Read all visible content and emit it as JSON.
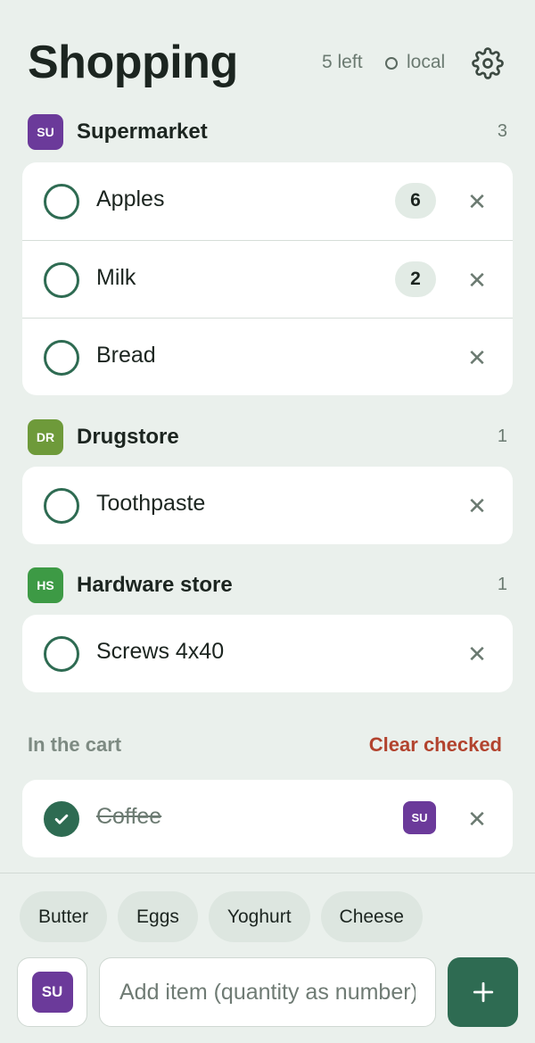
{
  "header": {
    "title": "Shopping",
    "left_count": "5 left",
    "sync_status": "local",
    "settings_icon": "gear-icon"
  },
  "groups": [
    {
      "badge": "SU",
      "badge_color": "#6b3a9a",
      "name": "Supermarket",
      "count": "3",
      "items": [
        {
          "name": "Apples",
          "qty": "6"
        },
        {
          "name": "Milk",
          "qty": "2"
        },
        {
          "name": "Bread"
        }
      ]
    },
    {
      "badge": "DR",
      "badge_color": "#6e9a3a",
      "name": "Drugstore",
      "count": "1",
      "items": [
        {
          "name": "Toothpaste"
        }
      ]
    },
    {
      "badge": "HS",
      "badge_color": "#3d9a45",
      "name": "Hardware store",
      "count": "1",
      "items": [
        {
          "name": "Screws 4x40"
        }
      ]
    }
  ],
  "cart": {
    "label": "In the cart",
    "clear_label": "Clear checked",
    "items": [
      {
        "name": "Coffee",
        "who": "SU",
        "checked": true
      }
    ]
  },
  "suggestions": [
    "Butter",
    "Eggs",
    "Yoghurt",
    "Cheese"
  ],
  "composer": {
    "assignee": "SU",
    "placeholder": "Add item (quantity as number)",
    "add_icon": "plus-icon"
  },
  "colors": {
    "accent": "#2e6b52",
    "danger": "#b2432e",
    "background": "#eaf0ec"
  }
}
